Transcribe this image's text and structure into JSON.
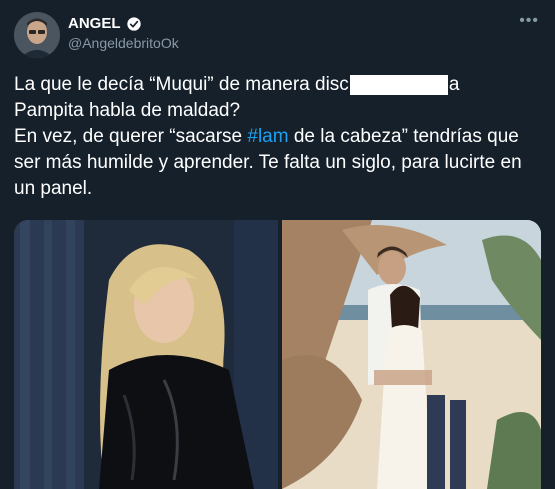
{
  "user": {
    "name": "ANGEL",
    "handle": "@AngeldebritoOk",
    "verified": true,
    "avatar_icon": "avatar-man-glasses"
  },
  "menu_icon": "more-dots-icon",
  "tweet": {
    "line1_before": "La que le decía “Muqui” de manera disc",
    "line1_after": "a",
    "line2": "Pampita habla de maldad?",
    "line3_before": "En vez, de querer “sacarse ",
    "hashtag": "#lam",
    "line3_after": " de la cabeza” tendrías que ser más humilde y aprender. Te falta un siglo, para lucirte en un panel."
  },
  "media": {
    "left_photo": "blonde-woman-black-leather-top",
    "right_photo": "couple-beach-floral-arch"
  },
  "colors": {
    "background": "#15202b",
    "text": "#ffffff",
    "secondary": "#8899a6",
    "hashtag": "#1da1f2"
  }
}
